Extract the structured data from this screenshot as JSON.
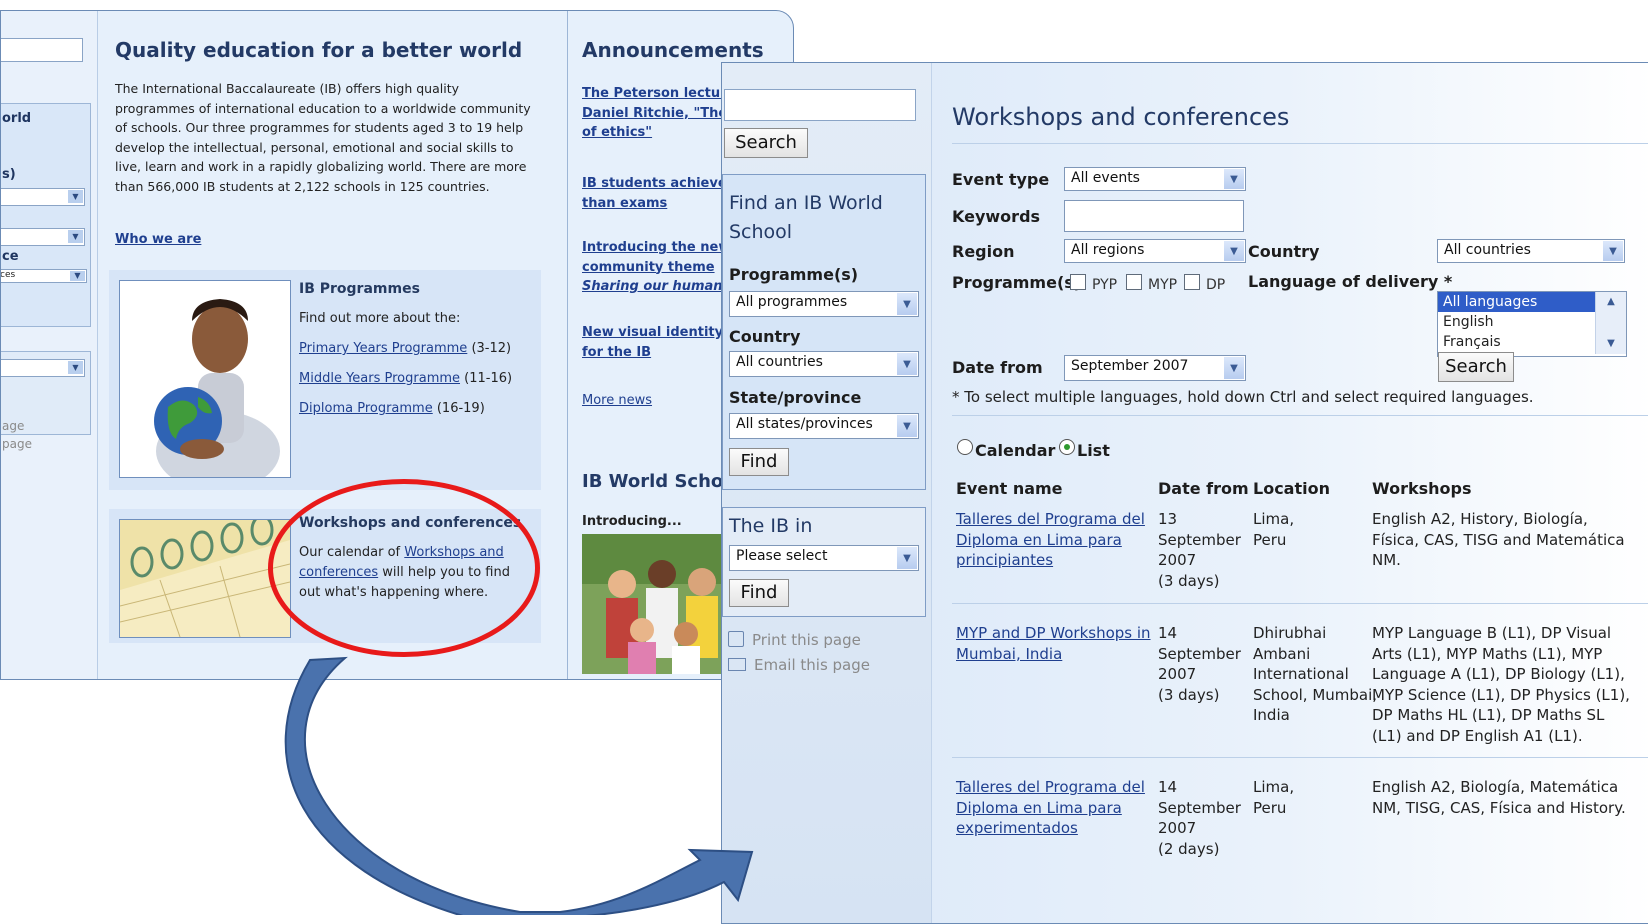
{
  "back": {
    "left_frag": {
      "orld": "orld",
      "s": "s)",
      "ce": "ce",
      "ces": "ces",
      "age1": "age",
      "age2": "page"
    },
    "title": "Quality education for a better world",
    "intro": "The International Baccalaureate (IB) offers high quality programmes of international education to a worldwide community of schools. Our three programmes for students aged 3 to 19 help develop the intellectual, personal, emotional and social skills to live, learn and work in a rapidly globalizing world. There are more than 566,000 IB students at 2,122 schools in 125 countries.",
    "who_we_are": "Who we are",
    "programmes": {
      "title": "IB Programmes",
      "sub": "Find out more about the:",
      "items": [
        {
          "label": "Primary Years Programme",
          "range": "(3-12)"
        },
        {
          "label": "Middle Years Programme",
          "range": "(11-16)"
        },
        {
          "label": "Diploma Programme",
          "range": "(16-19)"
        }
      ]
    },
    "workshops": {
      "title": "Workshops and conferences",
      "pre": "Our calendar of ",
      "link": "Workshops and conferences",
      "post": " will help you to find out what's happening where."
    },
    "announcements": {
      "title": "Announcements",
      "items": [
        "The Peterson lecture Daniel Ritchie, \"The future of ethics\"",
        "IB students achieve more than exams",
        "Introducing the new community theme",
        "New visual identity for the IB"
      ],
      "sharing": "Sharing our human",
      "more_news": "More news",
      "world_schools": "IB World Schools",
      "introducing": "Introducing..."
    }
  },
  "front": {
    "search_button": "Search",
    "find_title": "Find an IB World School",
    "programmes_label": "Programme(s)",
    "programmes_value": "All programmes",
    "country_label": "Country",
    "country_value": "All countries",
    "state_label": "State/province",
    "state_value": "All states/provinces",
    "find_button": "Find",
    "ib_in_title": "The IB in",
    "ib_in_value": "Please select",
    "find_button2": "Find",
    "print_page": "Print this page",
    "email_page": "Email this page",
    "title": "Workshops and conferences",
    "form": {
      "event_type_label": "Event type",
      "event_type_value": "All events",
      "keywords_label": "Keywords",
      "keywords_value": "",
      "region_label": "Region",
      "region_value": "All regions",
      "country_label": "Country",
      "country_value": "All countries",
      "programmes_label": "Programme(s)",
      "pyp": "PYP",
      "myp": "MYP",
      "dp": "DP",
      "language_label": "Language of delivery *",
      "languages": [
        "All languages",
        "English",
        "Français"
      ],
      "date_from_label": "Date from",
      "date_from_value": "September 2007",
      "search_button": "Search",
      "note": "* To select multiple languages, hold down Ctrl and select required languages."
    },
    "view": {
      "calendar": "Calendar",
      "list": "List",
      "selected": "List"
    },
    "table": {
      "headers": [
        "Event name",
        "Date from",
        "Location",
        "Workshops"
      ],
      "rows": [
        {
          "name": [
            "Talleres del Programa del",
            "Diploma en Lima para",
            "principiantes"
          ],
          "date": [
            "13",
            "September",
            "2007",
            "(3 days)"
          ],
          "location": [
            "Lima,",
            "Peru"
          ],
          "workshops": [
            "English A2, History, Biología,",
            "Física, CAS, TISG and Matemática",
            "NM."
          ]
        },
        {
          "name": [
            "MYP and DP Workshops in",
            "Mumbai, India"
          ],
          "date": [
            "14",
            "September",
            "2007",
            "(3 days)"
          ],
          "location": [
            "Dhirubhai",
            "Ambani",
            "International",
            "School, Mumbai,",
            "India"
          ],
          "workshops": [
            "MYP Language B (L1), DP Visual",
            "Arts (L1), MYP Maths (L1), MYP",
            "Language A (L1), DP Biology (L1),",
            "MYP Science (L1), DP Physics (L1),",
            "DP Maths HL (L1), DP Maths SL",
            "(L1) and DP English A1 (L1)."
          ]
        },
        {
          "name": [
            "Talleres del Programa del",
            "Diploma en Lima para",
            "experimentados"
          ],
          "date": [
            "14",
            "September",
            "2007",
            "(2 days)"
          ],
          "location": [
            "Lima,",
            "Peru"
          ],
          "workshops": [
            "English A2, Biología, Matemática",
            "NM, TISG, CAS, Física and History."
          ]
        }
      ]
    }
  },
  "colors": {
    "highlight": "#e81a1a",
    "arrow": "#4a72ad",
    "link": "#1f3f8f",
    "heading": "#233a66"
  }
}
